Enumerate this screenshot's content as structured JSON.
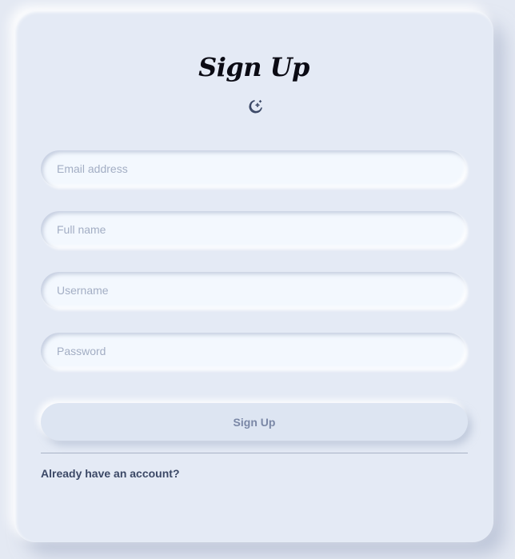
{
  "form": {
    "title": "Sign Up",
    "theme_toggle_icon": "moon-stars-icon",
    "fields": [
      {
        "placeholder": "Email address",
        "value": ""
      },
      {
        "placeholder": "Full name",
        "value": ""
      },
      {
        "placeholder": "Username",
        "value": ""
      },
      {
        "placeholder": "Password",
        "value": ""
      }
    ],
    "submit_label": "Sign Up",
    "login_link": "Already have an account?"
  },
  "colors": {
    "background": "#e4e9f3",
    "card": "#e4eaf5",
    "input": "#f3f8fe",
    "title": "#0b0b14",
    "link": "#3b4866",
    "button_text": "#7a87a6"
  }
}
